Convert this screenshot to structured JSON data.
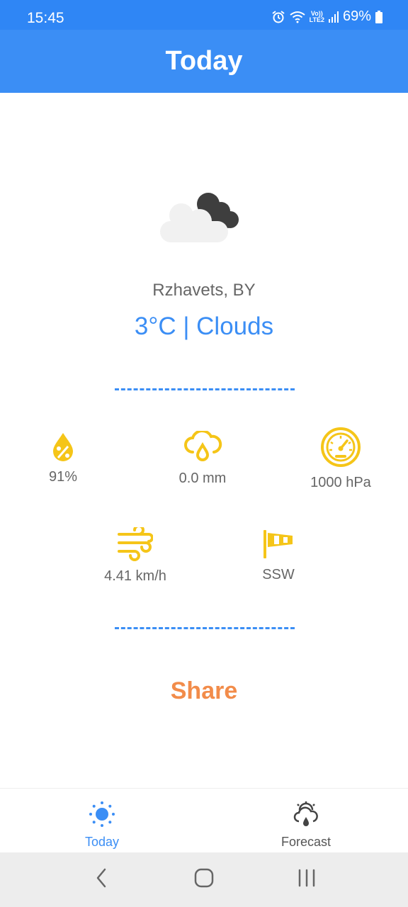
{
  "status_bar": {
    "time": "15:45",
    "network_top": "Vo))",
    "network_bottom": "LTE2",
    "battery": "69%",
    "icons": [
      "alarm-icon",
      "wifi-icon",
      "signal-icon",
      "battery-icon"
    ]
  },
  "app_bar": {
    "title": "Today"
  },
  "weather": {
    "icon": "cloud-icon",
    "location": "Rzhavets, BY",
    "summary": "3°C | Clouds"
  },
  "metrics": {
    "humidity": {
      "icon": "humidity-drop-icon",
      "value": "91%"
    },
    "precipitation": {
      "icon": "rain-cloud-icon",
      "value": "0.0 mm"
    },
    "pressure": {
      "icon": "pressure-gauge-icon",
      "value": "1000 hPa"
    },
    "wind_speed": {
      "icon": "wind-icon",
      "value": "4.41 km/h"
    },
    "wind_direction": {
      "icon": "windsock-icon",
      "value": "SSW"
    }
  },
  "share": {
    "label": "Share"
  },
  "bottom_nav": {
    "items": [
      {
        "label": "Today",
        "icon": "sun-icon",
        "active": true
      },
      {
        "label": "Forecast",
        "icon": "forecast-icon",
        "active": false
      }
    ]
  },
  "system_nav": {
    "icons": [
      "back-icon",
      "home-icon",
      "recents-icon"
    ]
  },
  "colors": {
    "primary": "#3B8EF5",
    "status_bar": "#2F86F5",
    "accent_icon": "#F5C518",
    "share": "#F28C4A",
    "text_secondary": "#666666"
  }
}
